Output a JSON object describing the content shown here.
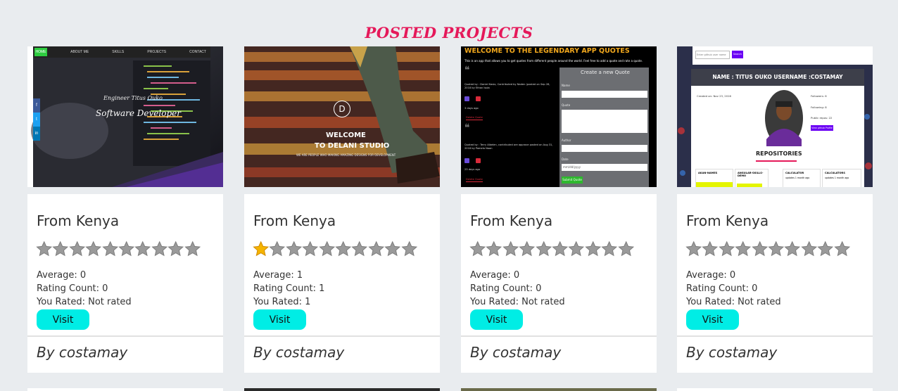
{
  "page": {
    "title": "POSTED PROJECTS"
  },
  "colors": {
    "title": "#e5195a",
    "visit_button": "#00ede5",
    "star_filled": "#f5b400",
    "star_empty": "#9a9a9a"
  },
  "projects": [
    {
      "country": "From Kenya",
      "rating": 0,
      "average": "Average: 0",
      "rating_count": "Rating Count: 0",
      "you_rated": "You Rated: Not rated",
      "visit_label": "Visit",
      "author": "By costamay",
      "preview": {
        "nav": [
          "HOME",
          "ABOUT ME",
          "SKILLS",
          "PROJECTS",
          "CONTACT"
        ],
        "heading": "Engineer Titus Ouko",
        "subheading": "Software Developer",
        "social": [
          "f",
          "t",
          "in"
        ]
      }
    },
    {
      "country": "From Kenya",
      "rating": 1,
      "average": "Average: 1",
      "rating_count": "Rating Count: 1",
      "you_rated": "You Rated: 1",
      "visit_label": "Visit",
      "author": "By costamay",
      "preview": {
        "logo": "D",
        "heading_1": "WELCOME",
        "heading_2": "TO DELANI STUDIO",
        "tagline": "WE ARE PEOPLE WHO MAKING AMAZING DESIGNS FOR DEVELOPMENT"
      }
    },
    {
      "country": "From Kenya",
      "rating": 0,
      "average": "Average: 0",
      "rating_count": "Rating Count: 0",
      "you_rated": "You Rated: Not rated",
      "visit_label": "Visit",
      "author": "By costamay",
      "preview": {
        "heading": "WELCOME TO THE LEGENDARY APP QUOTES",
        "intro": "This is an app that allows you to get quotes from different people around the world. Feel free to add a quote and rate a quote.",
        "quote_1": "Quoted by : Daniel Kasio, Contributed by Naden (posted on Sep 28, 2018 by Ethan Isola",
        "time_1": "3 days ago",
        "quote_2": "Quoted by : Terry Albelen, contributed are approve posted on Aug 31, 2018 by Pamela Naan",
        "time_2": "23 days ago",
        "delete_label": "Delete Quote",
        "form_title": "Create a new Quote",
        "field_name": "Name",
        "field_quote": "Quote",
        "field_author": "Author",
        "field_date": "Date",
        "date_placeholder": "mm/dd/yyyy",
        "submit": "Submit Quote"
      }
    },
    {
      "country": "From Kenya",
      "rating": 0,
      "average": "Average: 0",
      "rating_count": "Rating Count: 0",
      "you_rated": "You Rated: Not rated",
      "visit_label": "Visit",
      "author": "By costamay",
      "preview": {
        "search_placeholder": "Enter github user name",
        "search_button": "Search",
        "name_bar": "NAME : TITUS OUKO USERNAME :COSTAMAY",
        "created": "Created on: Nov 23, 2016",
        "followers": "Followers: 6",
        "following": "Following: 8",
        "public_repos": "Public repos: 22",
        "view_profile": "View github Profile",
        "repos_heading": "REPOSITORIES",
        "repos": [
          "AKAN-NAMES",
          "ANGULAR-SKILLS-DEMO",
          "CALCULATOR",
          "CALCULATORS"
        ],
        "repo_notes": [
          "",
          "",
          "updates 1 month ago",
          "updates 1 month ago"
        ]
      }
    }
  ]
}
